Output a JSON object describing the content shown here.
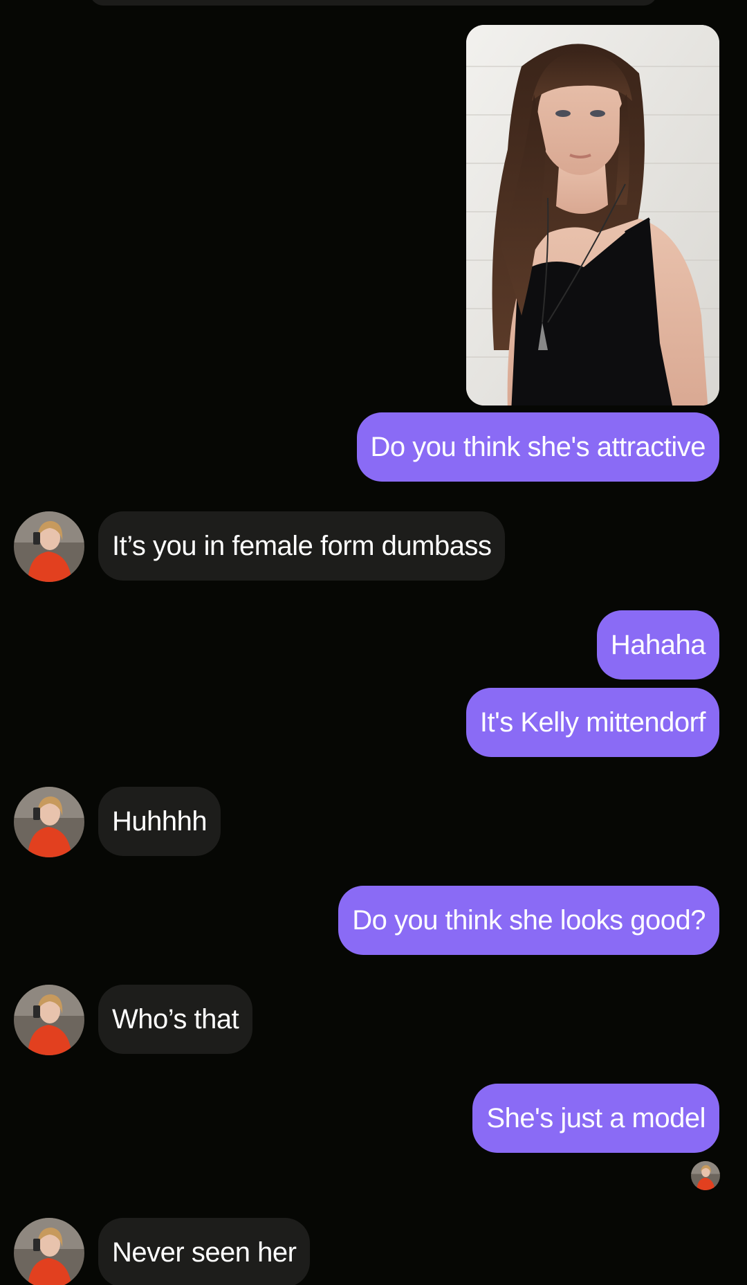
{
  "conversation": {
    "messages": [
      {
        "sender": "me",
        "type": "image",
        "image_description_icon": "photo-of-woman-in-black-top"
      },
      {
        "sender": "me",
        "text": "Do you think she's attractive"
      },
      {
        "sender": "them",
        "text": "It’s you in female form dumbass"
      },
      {
        "sender": "me",
        "text": "Hahaha"
      },
      {
        "sender": "me",
        "text": "It's Kelly mittendorf"
      },
      {
        "sender": "them",
        "text": "Huhhhh"
      },
      {
        "sender": "me",
        "text": "Do you think she looks good?"
      },
      {
        "sender": "them",
        "text": "Who’s that"
      },
      {
        "sender": "me",
        "text": "She's just a model"
      },
      {
        "sender": "them",
        "text": "Never seen her"
      }
    ]
  },
  "colors": {
    "background": "#060704",
    "sent_bubble": "#8a6bf5",
    "received_bubble": "#1d1d1b"
  }
}
